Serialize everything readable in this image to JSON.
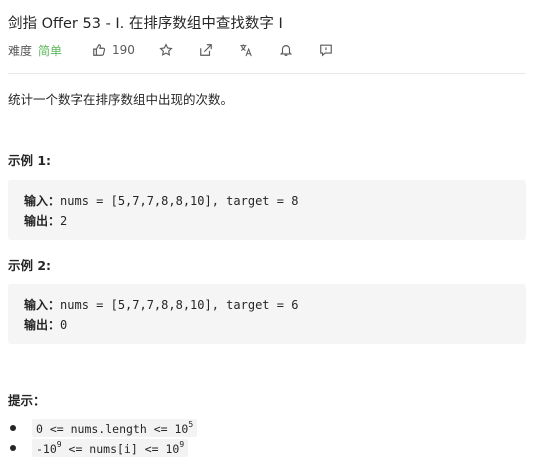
{
  "problem": {
    "title": "剑指 Offer 53 - I. 在排序数组中查找数字 I",
    "difficulty_label": "难度",
    "difficulty_value": "简单",
    "likes": "190",
    "description": "统计一个数字在排序数组中出现的次数。"
  },
  "icons": [
    "thumb-up-icon",
    "star-icon",
    "share-icon",
    "translate-icon",
    "bell-icon",
    "feedback-icon"
  ],
  "colors": {
    "easy": "#5cb85c",
    "code_bg": "#f5f5f5"
  },
  "examples": [
    {
      "heading": "示例 1:",
      "input_label": "输入：",
      "input_value": "nums = [5,7,7,8,8,10], target = 8",
      "output_label": "输出：",
      "output_value": "2"
    },
    {
      "heading": "示例 2:",
      "input_label": "输入：",
      "input_value": "nums = [5,7,7,8,8,10], target = 6",
      "output_label": "输出：",
      "output_value": "0"
    }
  ],
  "hints": {
    "title": "提示：",
    "items": [
      {
        "text": "0 <= nums.length <= 10",
        "sup": "5"
      },
      {
        "pre": "-10",
        "pre_sup": "9",
        "text": " <= nums[i] <= 10",
        "sup": "9"
      }
    ]
  }
}
